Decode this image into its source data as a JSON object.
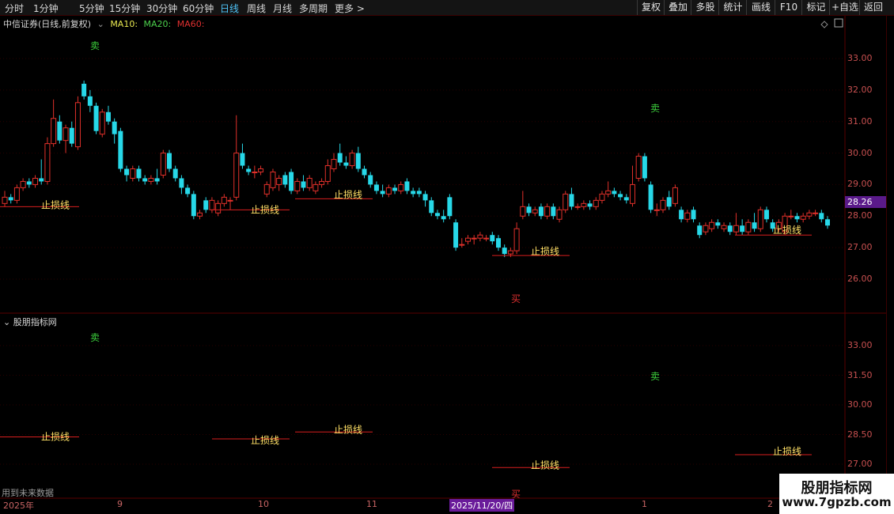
{
  "toolbar": {
    "periods": [
      "分时",
      "1分钟",
      "5分钟",
      "15分钟",
      "30分钟",
      "60分钟",
      "日线",
      "周线",
      "月线",
      "多周期",
      "更多 >"
    ],
    "active_period": "日线",
    "right_buttons": [
      "复权",
      "叠加",
      "多股",
      "统计",
      "画线",
      "F10",
      "标记",
      "+自选",
      "返回"
    ]
  },
  "stock": {
    "title": "中信证券(日线,前复权)",
    "ma10": "MA10:",
    "ma20": "MA20:",
    "ma60": "MA60:"
  },
  "main_axis": {
    "ticks": [
      "33.00",
      "32.00",
      "31.00",
      "30.00",
      "29.00",
      "28.00",
      "27.00",
      "26.00"
    ],
    "ylim": [
      25.0,
      34.0
    ]
  },
  "current_price": "28.26",
  "indicator": {
    "title": "股朋指标网",
    "ticks": [
      "33.00",
      "31.50",
      "30.00",
      "28.50",
      "27.00"
    ],
    "ylim": [
      26.0,
      34.0
    ],
    "future_note": "用到未来数据"
  },
  "signals": {
    "sell_label": "卖",
    "buy_label": "买",
    "stop_label": "止损线"
  },
  "x_axis": {
    "labels": [
      "2025年",
      "9",
      "10",
      "11",
      "2025/11/20/四",
      "1",
      "2"
    ],
    "selected": "2025/11/20/四"
  },
  "watermark": {
    "line1": "股朋指标网",
    "line2": "www.7gpzb.com"
  },
  "colors": {
    "up": "#e0302a",
    "down": "#27d8e8",
    "stop_line": "#d81e1e",
    "stop_text": "#ffe066",
    "sell": "#3cd03c",
    "buy": "#e03030",
    "accent": "#4fc3f7"
  },
  "chart_data": {
    "type": "candlestick",
    "stop_levels": [
      {
        "label": "止损线",
        "value": 28.3
      },
      {
        "label": "止损线",
        "value": 28.2
      },
      {
        "label": "止损线",
        "value": 28.55
      },
      {
        "label": "止损线",
        "value": 26.75
      },
      {
        "label": "止损线",
        "value": 27.4
      }
    ],
    "candles": [
      {
        "o": 28.4,
        "c": 28.6,
        "h": 28.8,
        "l": 28.3
      },
      {
        "o": 28.6,
        "c": 28.5,
        "h": 28.7,
        "l": 28.4
      },
      {
        "o": 28.5,
        "c": 28.9,
        "h": 29.0,
        "l": 28.4
      },
      {
        "o": 28.9,
        "c": 29.1,
        "h": 29.2,
        "l": 28.8
      },
      {
        "o": 29.1,
        "c": 29.0,
        "h": 29.2,
        "l": 28.9
      },
      {
        "o": 29.0,
        "c": 29.2,
        "h": 29.3,
        "l": 28.9
      },
      {
        "o": 29.2,
        "c": 29.1,
        "h": 29.8,
        "l": 29.0
      },
      {
        "o": 29.1,
        "c": 30.3,
        "h": 30.5,
        "l": 29.0
      },
      {
        "o": 30.3,
        "c": 31.1,
        "h": 31.7,
        "l": 30.2
      },
      {
        "o": 31.0,
        "c": 30.4,
        "h": 31.2,
        "l": 30.3
      },
      {
        "o": 30.4,
        "c": 30.8,
        "h": 30.9,
        "l": 30.0
      },
      {
        "o": 30.8,
        "c": 30.3,
        "h": 31.0,
        "l": 30.2
      },
      {
        "o": 30.2,
        "c": 31.6,
        "h": 31.8,
        "l": 30.1
      },
      {
        "o": 32.2,
        "c": 31.8,
        "h": 32.3,
        "l": 31.7
      },
      {
        "o": 31.8,
        "c": 31.5,
        "h": 32.0,
        "l": 31.3
      },
      {
        "o": 31.5,
        "c": 30.7,
        "h": 31.6,
        "l": 30.6
      },
      {
        "o": 30.6,
        "c": 31.3,
        "h": 31.4,
        "l": 30.5
      },
      {
        "o": 31.3,
        "c": 31.0,
        "h": 31.5,
        "l": 30.9
      },
      {
        "o": 31.0,
        "c": 30.6,
        "h": 31.1,
        "l": 30.3
      },
      {
        "o": 30.7,
        "c": 29.5,
        "h": 30.8,
        "l": 29.4
      },
      {
        "o": 29.5,
        "c": 29.3,
        "h": 29.6,
        "l": 29.1
      },
      {
        "o": 29.2,
        "c": 29.5,
        "h": 29.6,
        "l": 29.1
      },
      {
        "o": 29.5,
        "c": 29.2,
        "h": 29.6,
        "l": 29.1
      },
      {
        "o": 29.2,
        "c": 29.1,
        "h": 29.3,
        "l": 29.0
      },
      {
        "o": 29.1,
        "c": 29.2,
        "h": 29.3,
        "l": 29.0
      },
      {
        "o": 29.2,
        "c": 29.1,
        "h": 29.5,
        "l": 29.0
      },
      {
        "o": 29.3,
        "c": 30.0,
        "h": 30.1,
        "l": 29.2
      },
      {
        "o": 30.0,
        "c": 29.5,
        "h": 30.1,
        "l": 29.4
      },
      {
        "o": 29.5,
        "c": 29.2,
        "h": 29.6,
        "l": 29.1
      },
      {
        "o": 29.2,
        "c": 28.9,
        "h": 29.3,
        "l": 28.7
      },
      {
        "o": 28.9,
        "c": 28.7,
        "h": 29.0,
        "l": 28.6
      },
      {
        "o": 28.7,
        "c": 28.0,
        "h": 28.8,
        "l": 27.9
      },
      {
        "o": 28.0,
        "c": 28.1,
        "h": 28.2,
        "l": 27.9
      },
      {
        "o": 28.5,
        "c": 28.2,
        "h": 28.6,
        "l": 28.1
      },
      {
        "o": 28.2,
        "c": 28.5,
        "h": 28.6,
        "l": 28.1
      },
      {
        "o": 28.1,
        "c": 28.4,
        "h": 28.5,
        "l": 28.0
      },
      {
        "o": 28.4,
        "c": 28.6,
        "h": 28.7,
        "l": 28.3
      },
      {
        "o": 28.5,
        "c": 28.5,
        "h": 28.6,
        "l": 28.2
      },
      {
        "o": 28.6,
        "c": 30.0,
        "h": 31.2,
        "l": 28.5
      },
      {
        "o": 30.0,
        "c": 29.6,
        "h": 30.3,
        "l": 29.5
      },
      {
        "o": 29.5,
        "c": 29.4,
        "h": 29.6,
        "l": 29.3
      },
      {
        "o": 29.4,
        "c": 29.4,
        "h": 29.6,
        "l": 29.2
      },
      {
        "o": 29.4,
        "c": 29.5,
        "h": 29.6,
        "l": 29.3
      },
      {
        "o": 28.7,
        "c": 29.0,
        "h": 29.1,
        "l": 28.6
      },
      {
        "o": 28.9,
        "c": 29.4,
        "h": 29.5,
        "l": 28.8
      },
      {
        "o": 29.0,
        "c": 29.2,
        "h": 29.3,
        "l": 28.8
      },
      {
        "o": 29.3,
        "c": 29.0,
        "h": 29.4,
        "l": 28.9
      },
      {
        "o": 29.4,
        "c": 28.8,
        "h": 29.5,
        "l": 28.7
      },
      {
        "o": 28.8,
        "c": 29.1,
        "h": 29.2,
        "l": 28.7
      },
      {
        "o": 29.1,
        "c": 28.9,
        "h": 29.3,
        "l": 28.8
      },
      {
        "o": 28.9,
        "c": 29.2,
        "h": 29.3,
        "l": 28.8
      },
      {
        "o": 28.8,
        "c": 29.0,
        "h": 29.1,
        "l": 28.7
      },
      {
        "o": 29.0,
        "c": 29.1,
        "h": 29.2,
        "l": 28.9
      },
      {
        "o": 29.1,
        "c": 29.6,
        "h": 29.8,
        "l": 29.0
      },
      {
        "o": 29.5,
        "c": 29.8,
        "h": 30.0,
        "l": 29.4
      },
      {
        "o": 30.0,
        "c": 29.7,
        "h": 30.3,
        "l": 29.6
      },
      {
        "o": 29.7,
        "c": 29.6,
        "h": 29.9,
        "l": 29.5
      },
      {
        "o": 29.6,
        "c": 30.0,
        "h": 30.1,
        "l": 29.5
      },
      {
        "o": 30.0,
        "c": 29.5,
        "h": 30.2,
        "l": 29.4
      },
      {
        "o": 29.5,
        "c": 29.3,
        "h": 29.6,
        "l": 29.2
      },
      {
        "o": 29.3,
        "c": 29.0,
        "h": 29.4,
        "l": 28.9
      },
      {
        "o": 29.0,
        "c": 28.8,
        "h": 29.1,
        "l": 28.7
      },
      {
        "o": 28.8,
        "c": 28.7,
        "h": 29.0,
        "l": 28.6
      },
      {
        "o": 28.7,
        "c": 28.9,
        "h": 29.0,
        "l": 28.6
      },
      {
        "o": 28.9,
        "c": 28.8,
        "h": 29.0,
        "l": 28.7
      },
      {
        "o": 28.8,
        "c": 29.0,
        "h": 29.1,
        "l": 28.7
      },
      {
        "o": 29.1,
        "c": 28.8,
        "h": 29.2,
        "l": 28.7
      },
      {
        "o": 28.8,
        "c": 28.7,
        "h": 28.9,
        "l": 28.6
      },
      {
        "o": 28.8,
        "c": 28.7,
        "h": 28.9,
        "l": 28.6
      },
      {
        "o": 28.7,
        "c": 28.5,
        "h": 28.8,
        "l": 28.3
      },
      {
        "o": 28.5,
        "c": 28.1,
        "h": 28.6,
        "l": 28.0
      },
      {
        "o": 28.1,
        "c": 28.0,
        "h": 28.2,
        "l": 27.9
      },
      {
        "o": 28.0,
        "c": 27.9,
        "h": 28.2,
        "l": 27.8
      },
      {
        "o": 28.6,
        "c": 28.0,
        "h": 28.7,
        "l": 27.9
      },
      {
        "o": 27.8,
        "c": 27.0,
        "h": 27.9,
        "l": 26.9
      },
      {
        "o": 27.1,
        "c": 27.1,
        "h": 27.3,
        "l": 27.0
      },
      {
        "o": 27.2,
        "c": 27.3,
        "h": 27.4,
        "l": 27.1
      },
      {
        "o": 27.3,
        "c": 27.3,
        "h": 27.4,
        "l": 27.1
      },
      {
        "o": 27.3,
        "c": 27.4,
        "h": 27.5,
        "l": 27.2
      },
      {
        "o": 27.3,
        "c": 27.3,
        "h": 27.4,
        "l": 27.2
      },
      {
        "o": 27.4,
        "c": 27.2,
        "h": 27.5,
        "l": 27.1
      },
      {
        "o": 27.3,
        "c": 27.0,
        "h": 27.4,
        "l": 26.9
      },
      {
        "o": 27.0,
        "c": 26.8,
        "h": 27.1,
        "l": 26.7
      },
      {
        "o": 26.8,
        "c": 26.9,
        "h": 27.0,
        "l": 26.7
      },
      {
        "o": 26.9,
        "c": 27.6,
        "h": 27.8,
        "l": 26.8
      },
      {
        "o": 28.0,
        "c": 28.3,
        "h": 28.8,
        "l": 27.9
      },
      {
        "o": 28.3,
        "c": 28.1,
        "h": 28.4,
        "l": 28.0
      },
      {
        "o": 28.1,
        "c": 28.2,
        "h": 28.3,
        "l": 28.0
      },
      {
        "o": 28.3,
        "c": 28.0,
        "h": 28.4,
        "l": 27.9
      },
      {
        "o": 28.0,
        "c": 28.3,
        "h": 28.4,
        "l": 27.9
      },
      {
        "o": 28.3,
        "c": 28.0,
        "h": 28.4,
        "l": 27.9
      },
      {
        "o": 27.9,
        "c": 28.2,
        "h": 28.3,
        "l": 27.8
      },
      {
        "o": 28.2,
        "c": 28.7,
        "h": 28.8,
        "l": 28.1
      },
      {
        "o": 28.7,
        "c": 28.3,
        "h": 28.9,
        "l": 28.2
      },
      {
        "o": 28.3,
        "c": 28.3,
        "h": 28.4,
        "l": 28.2
      },
      {
        "o": 28.3,
        "c": 28.4,
        "h": 28.5,
        "l": 28.2
      },
      {
        "o": 28.4,
        "c": 28.3,
        "h": 28.5,
        "l": 28.2
      },
      {
        "o": 28.3,
        "c": 28.5,
        "h": 28.6,
        "l": 28.2
      },
      {
        "o": 28.5,
        "c": 28.7,
        "h": 28.8,
        "l": 28.4
      },
      {
        "o": 28.7,
        "c": 28.8,
        "h": 29.1,
        "l": 28.6
      },
      {
        "o": 28.8,
        "c": 28.7,
        "h": 28.9,
        "l": 28.6
      },
      {
        "o": 28.7,
        "c": 28.6,
        "h": 28.8,
        "l": 28.5
      },
      {
        "o": 28.6,
        "c": 28.5,
        "h": 28.7,
        "l": 28.4
      },
      {
        "o": 28.4,
        "c": 29.0,
        "h": 29.6,
        "l": 28.3
      },
      {
        "o": 29.2,
        "c": 29.9,
        "h": 30.0,
        "l": 29.1
      },
      {
        "o": 29.9,
        "c": 29.2,
        "h": 30.0,
        "l": 29.1
      },
      {
        "o": 29.0,
        "c": 28.2,
        "h": 29.1,
        "l": 28.1
      },
      {
        "o": 28.2,
        "c": 28.2,
        "h": 28.4,
        "l": 28.0
      },
      {
        "o": 28.2,
        "c": 28.5,
        "h": 28.6,
        "l": 28.1
      },
      {
        "o": 28.6,
        "c": 28.3,
        "h": 28.8,
        "l": 28.2
      },
      {
        "o": 28.4,
        "c": 28.9,
        "h": 29.0,
        "l": 28.3
      },
      {
        "o": 28.2,
        "c": 27.9,
        "h": 28.3,
        "l": 27.8
      },
      {
        "o": 27.9,
        "c": 28.1,
        "h": 28.2,
        "l": 27.8
      },
      {
        "o": 28.2,
        "c": 27.9,
        "h": 28.3,
        "l": 27.8
      },
      {
        "o": 27.7,
        "c": 27.4,
        "h": 27.8,
        "l": 27.3
      },
      {
        "o": 27.5,
        "c": 27.7,
        "h": 27.8,
        "l": 27.4
      },
      {
        "o": 27.6,
        "c": 27.8,
        "h": 27.9,
        "l": 27.5
      },
      {
        "o": 27.8,
        "c": 27.7,
        "h": 27.9,
        "l": 27.6
      },
      {
        "o": 27.6,
        "c": 27.7,
        "h": 27.8,
        "l": 27.5
      },
      {
        "o": 27.7,
        "c": 27.5,
        "h": 27.8,
        "l": 27.4
      },
      {
        "o": 27.5,
        "c": 27.7,
        "h": 28.1,
        "l": 27.4
      },
      {
        "o": 27.7,
        "c": 27.5,
        "h": 27.9,
        "l": 27.4
      },
      {
        "o": 27.5,
        "c": 27.8,
        "h": 27.9,
        "l": 27.4
      },
      {
        "o": 27.8,
        "c": 27.6,
        "h": 28.1,
        "l": 27.5
      },
      {
        "o": 27.6,
        "c": 28.2,
        "h": 28.3,
        "l": 27.5
      },
      {
        "o": 28.2,
        "c": 27.9,
        "h": 28.3,
        "l": 27.8
      },
      {
        "o": 27.8,
        "c": 27.6,
        "h": 27.9,
        "l": 27.5
      },
      {
        "o": 27.6,
        "c": 27.8,
        "h": 27.9,
        "l": 27.5
      },
      {
        "o": 27.5,
        "c": 28.0,
        "h": 28.1,
        "l": 27.4
      },
      {
        "o": 28.0,
        "c": 28.0,
        "h": 28.2,
        "l": 27.9
      },
      {
        "o": 28.0,
        "c": 27.9,
        "h": 28.1,
        "l": 27.8
      },
      {
        "o": 27.9,
        "c": 28.0,
        "h": 28.1,
        "l": 27.8
      },
      {
        "o": 28.0,
        "c": 28.1,
        "h": 28.2,
        "l": 27.9
      },
      {
        "o": 28.1,
        "c": 28.1,
        "h": 28.2,
        "l": 28.0
      },
      {
        "o": 28.1,
        "c": 27.9,
        "h": 28.2,
        "l": 27.8
      },
      {
        "o": 27.9,
        "c": 27.7,
        "h": 28.0,
        "l": 27.6
      }
    ]
  }
}
